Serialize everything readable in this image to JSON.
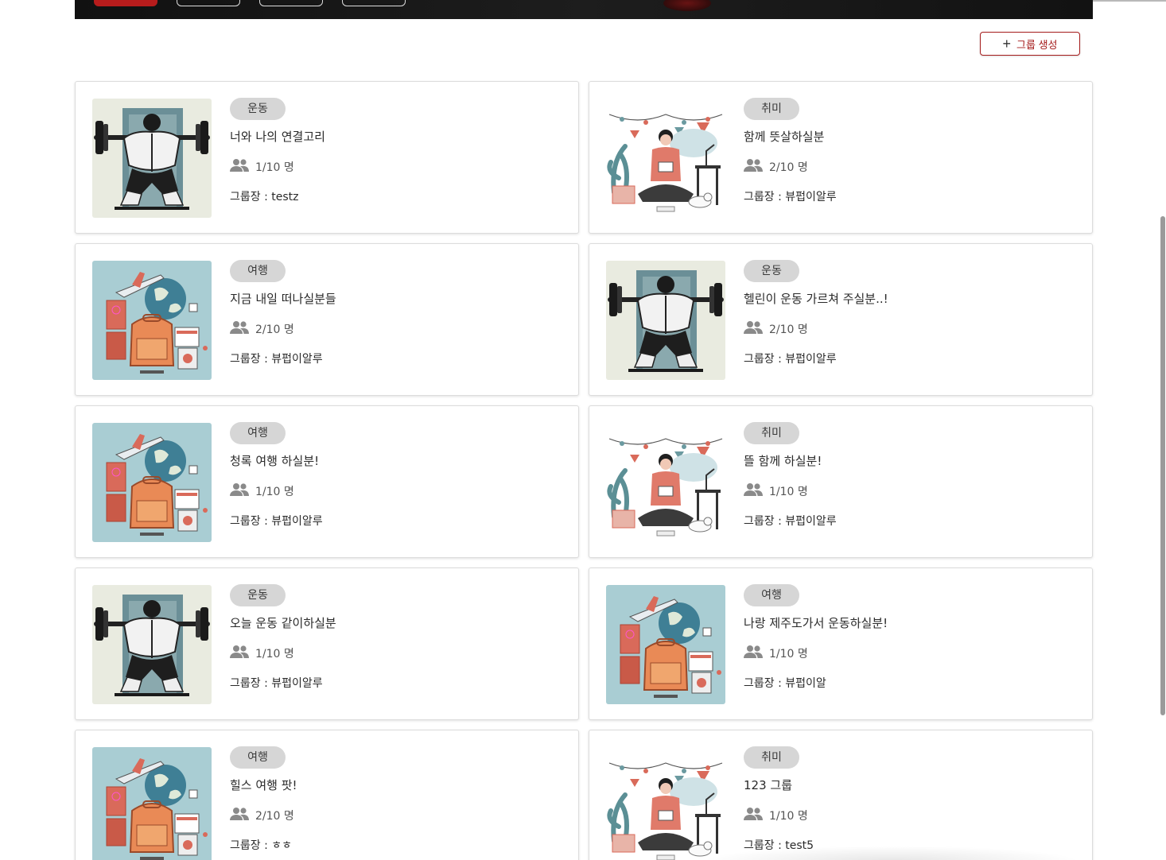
{
  "header": {
    "create_label": "그룹 생성"
  },
  "colors": {
    "accent": "#a51c1c",
    "chip_bg": "#d6d6d6"
  },
  "groups": [
    {
      "category": "운동",
      "title": "너와 나의 연결고리",
      "members": "1/10 명",
      "leader": "그룹장 : testz",
      "thumb": "fitness"
    },
    {
      "category": "취미",
      "title": "함께 뜻살하실분",
      "members": "2/10 명",
      "leader": "그룹장 : 뷰펍이알루",
      "thumb": "hobby"
    },
    {
      "category": "여행",
      "title": "지금 내일 떠나실분들",
      "members": "2/10 명",
      "leader": "그룹장 : 뷰펍이알루",
      "thumb": "travel"
    },
    {
      "category": "운동",
      "title": "헬린이 운동 가르쳐 주실분..!",
      "members": "2/10 명",
      "leader": "그룹장 : 뷰펍이알루",
      "thumb": "fitness"
    },
    {
      "category": "여행",
      "title": "청록 여행 하실분!",
      "members": "1/10 명",
      "leader": "그룹장 : 뷰펍이알루",
      "thumb": "travel"
    },
    {
      "category": "취미",
      "title": "뜰 함께 하실분!",
      "members": "1/10 명",
      "leader": "그룹장 : 뷰펍이알루",
      "thumb": "hobby"
    },
    {
      "category": "운동",
      "title": "오늘 운동 같이하실분",
      "members": "1/10 명",
      "leader": "그룹장 : 뷰펍이알루",
      "thumb": "fitness"
    },
    {
      "category": "여행",
      "title": "나랑 제주도가서 운동하실분!",
      "members": "1/10 명",
      "leader": "그룹장 : 뷰펍이알",
      "thumb": "travel"
    },
    {
      "category": "여행",
      "title": "힐스 여행 팟!",
      "members": "2/10 명",
      "leader": "그룹장 : ㅎㅎ",
      "thumb": "travel"
    },
    {
      "category": "취미",
      "title": "123 그룹",
      "members": "1/10 명",
      "leader": "그룹장 : test5",
      "thumb": "hobby"
    }
  ]
}
